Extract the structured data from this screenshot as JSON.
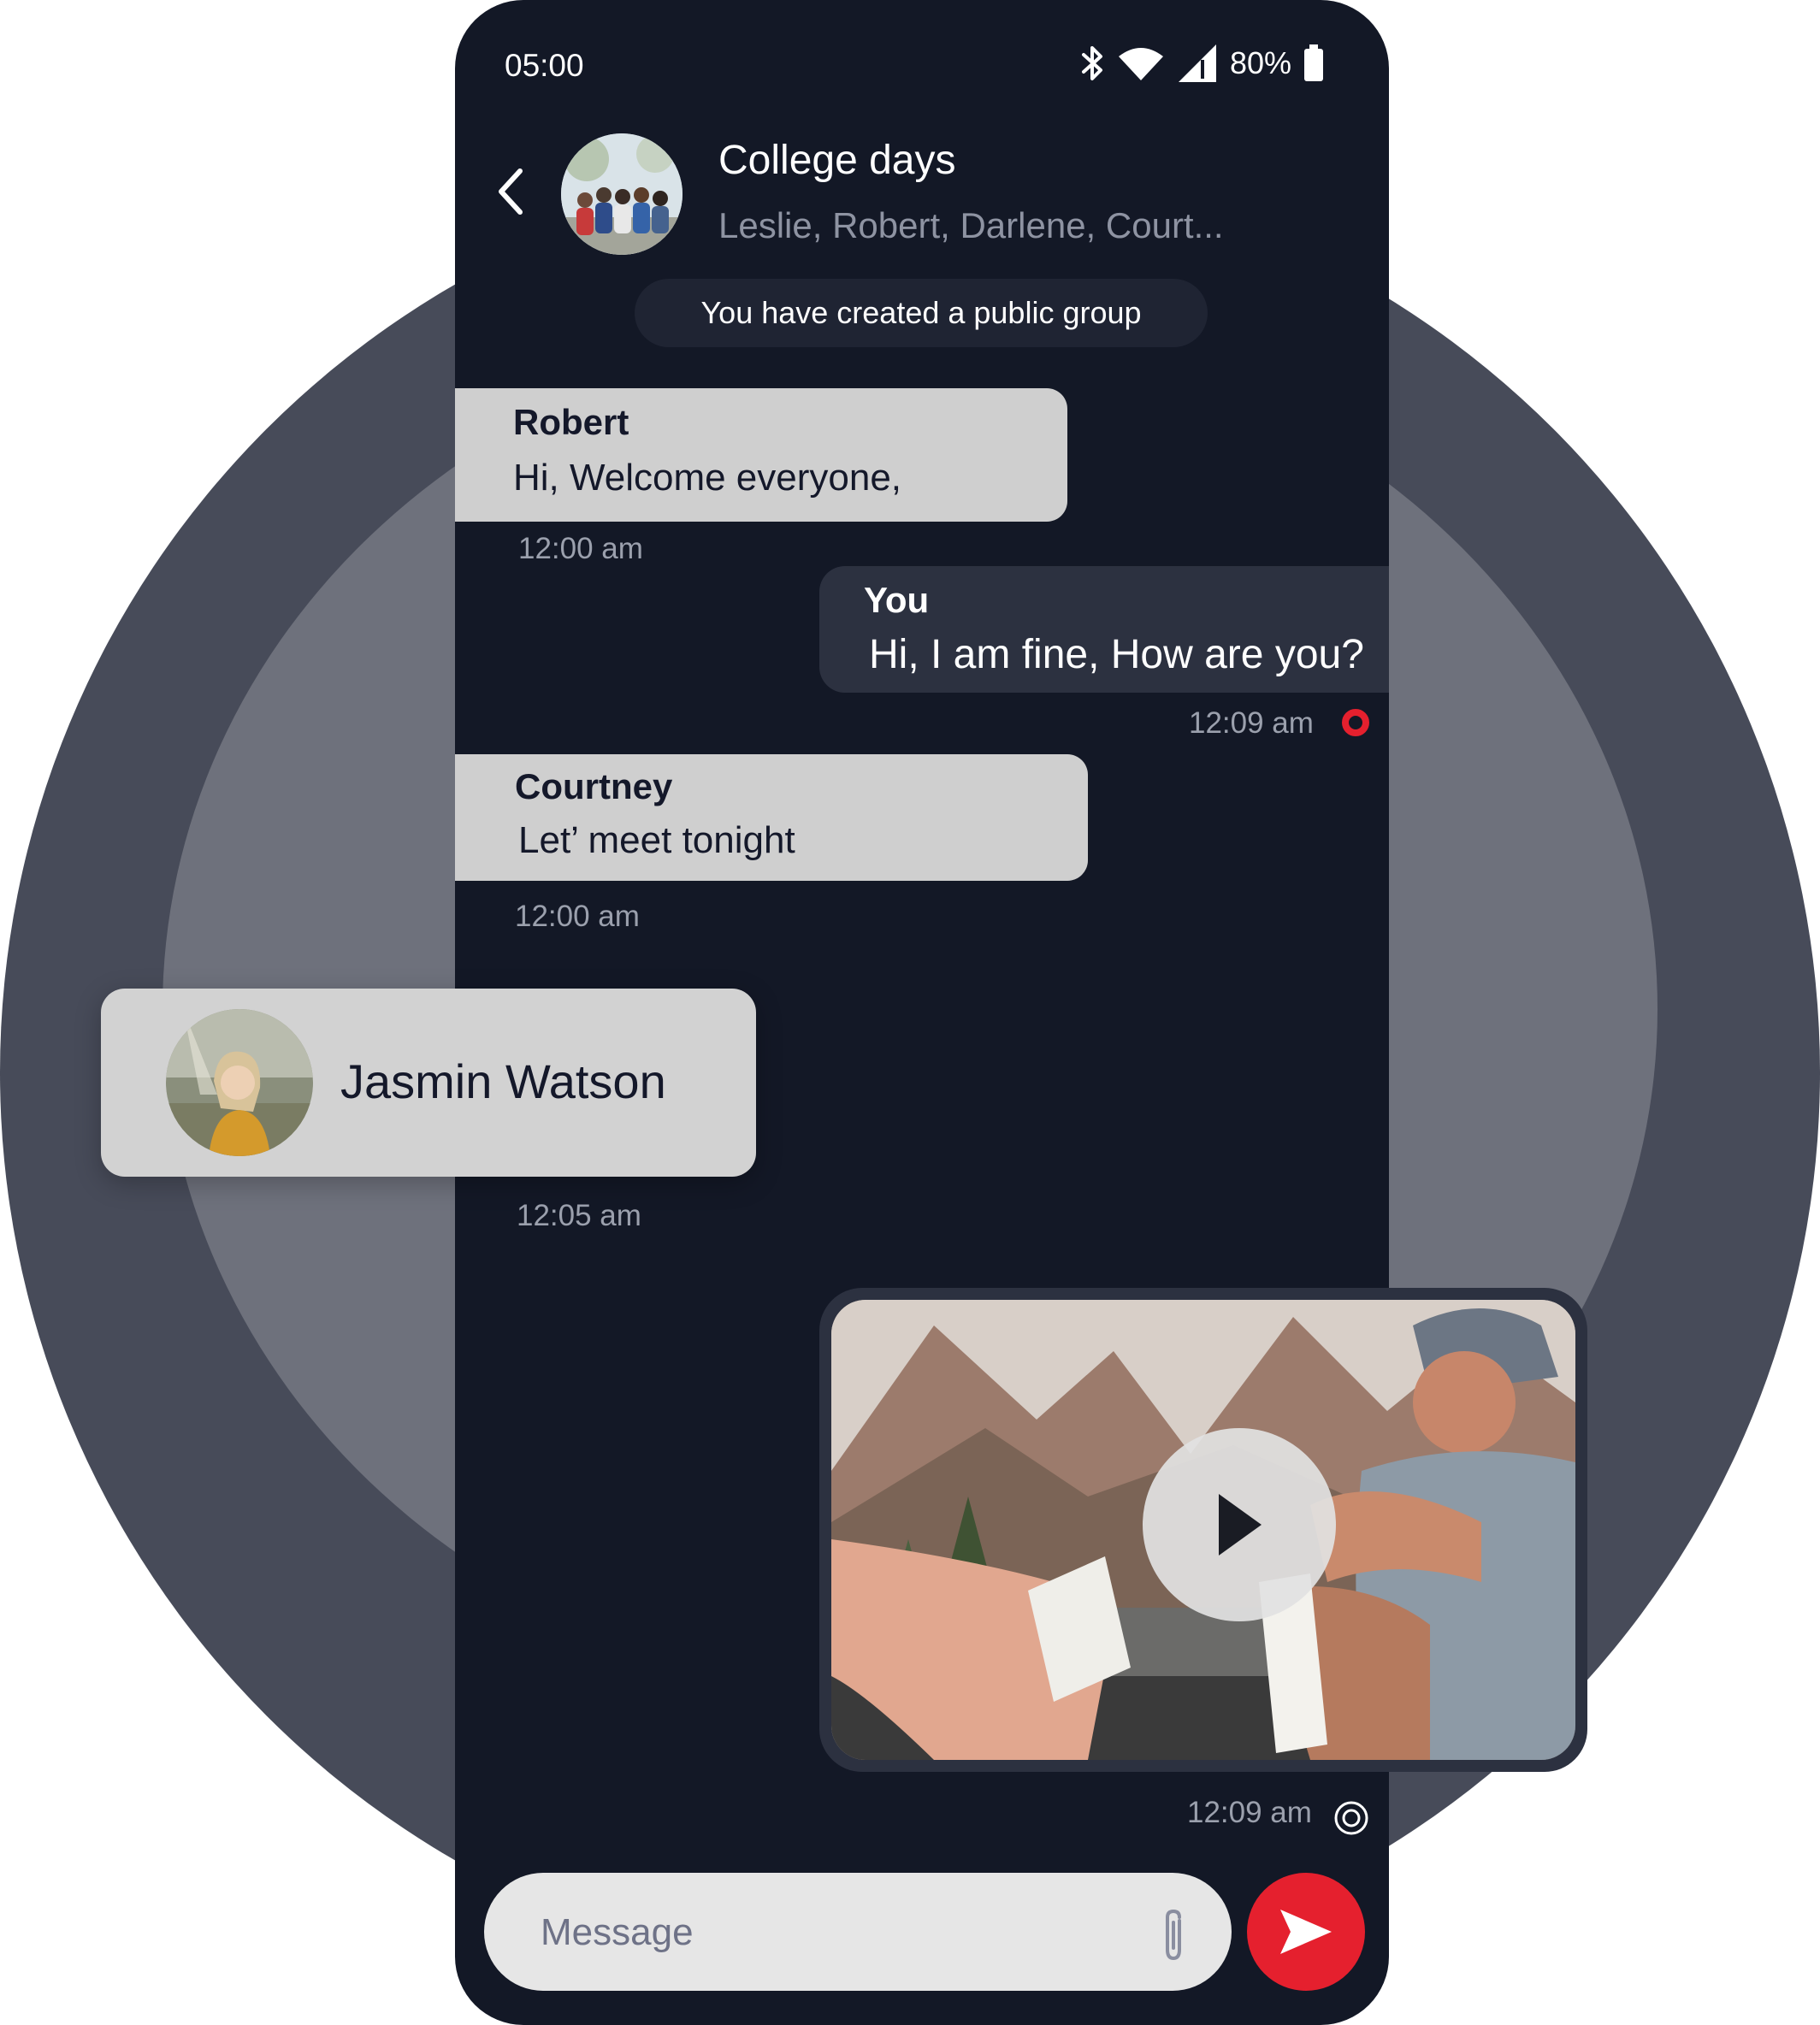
{
  "status_bar": {
    "time": "05:00",
    "battery": "80%",
    "icons": [
      "bluetooth-icon",
      "wifi-icon",
      "signal-icon",
      "battery-icon"
    ]
  },
  "header": {
    "back_icon": "chevron-left-icon",
    "title": "College days",
    "subtitle": "Leslie, Robert, Darlene, Court..."
  },
  "system_message": "You have created a public group",
  "messages": [
    {
      "sender": "Robert",
      "text": "Hi, Welcome everyone,",
      "time": "12:00 am",
      "direction": "incoming"
    },
    {
      "sender": "You",
      "text": "Hi, I am fine, How are you?",
      "time": "12:09 am",
      "direction": "outgoing"
    },
    {
      "sender": "Courtney",
      "text": "Let’ meet tonight",
      "time": "12:00 am",
      "direction": "incoming"
    }
  ],
  "contact_card": {
    "name": "Jasmin Watson",
    "time": "12:05 am"
  },
  "video_message": {
    "time": "12:09 am",
    "play_icon": "play-icon",
    "status_icon": "sent-ring-icon"
  },
  "composer": {
    "placeholder": "Message",
    "attach_icon": "paperclip-icon",
    "send_icon": "send-arrow-icon"
  },
  "colors": {
    "accent": "#e5202e",
    "phone_bg": "#131826",
    "incoming_bubble": "#cfcfcf",
    "outgoing_bubble": "#2c3140",
    "timestamp": "#9ba0ad"
  }
}
